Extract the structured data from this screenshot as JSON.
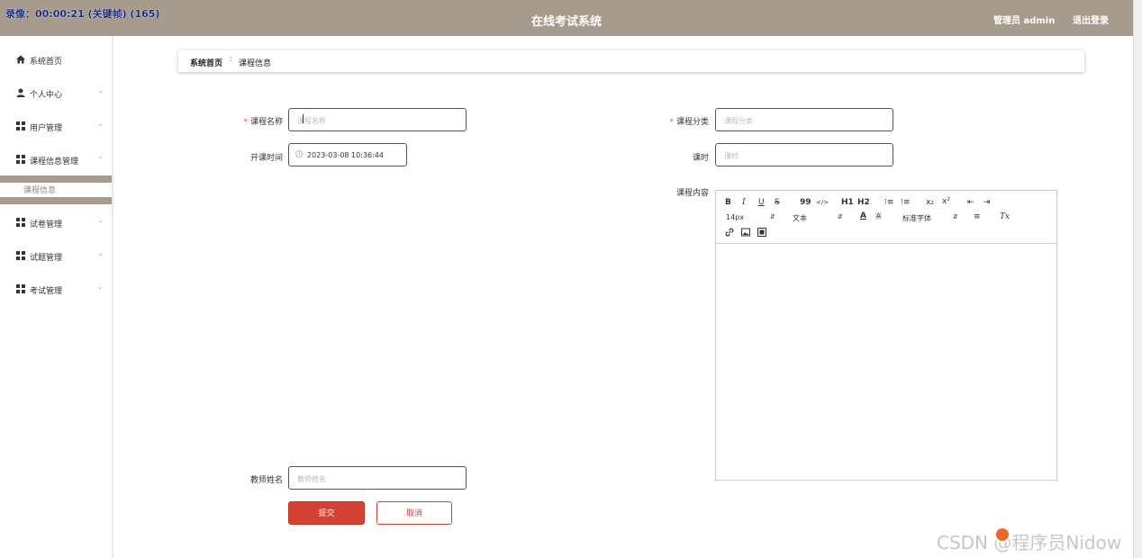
{
  "recorder": {
    "text": "录像：00:00:21 (关键帧) (165)"
  },
  "header": {
    "title": "在线考试系统",
    "user": "管理员 admin",
    "logout": "退出登录",
    "bar_color": "#a69b8c"
  },
  "sidebar": {
    "items": [
      {
        "label": "系统首页",
        "icon": "home-icon"
      },
      {
        "label": "个人中心",
        "icon": "user-icon"
      },
      {
        "label": "用户管理",
        "icon": "grid-icon"
      },
      {
        "label": "课程信息管理",
        "icon": "grid-icon",
        "expanded": true
      },
      {
        "label": "试卷管理",
        "icon": "grid-icon"
      },
      {
        "label": "试题管理",
        "icon": "grid-icon"
      },
      {
        "label": "考试管理",
        "icon": "grid-icon"
      }
    ],
    "sub_item": "课程信息"
  },
  "breadcrumb": {
    "home": "系统首页",
    "separator": "∶",
    "current": "课程信息"
  },
  "form": {
    "course_name": {
      "label": "课程名称",
      "placeholder": "课程名称",
      "required": true
    },
    "course_category": {
      "label": "课程分类",
      "placeholder": "课程分类",
      "required": true
    },
    "start_time": {
      "label": "开课时间",
      "value": "2023-03-08 10:36:44"
    },
    "hours": {
      "label": "课时",
      "placeholder": "课时"
    },
    "content": {
      "label": "课程内容"
    },
    "teacher": {
      "label": "教师姓名",
      "placeholder": "教师姓名"
    },
    "submit": "提交",
    "cancel": "取消"
  },
  "editor": {
    "row1": [
      "B",
      "I",
      "U",
      "S",
      "99",
      "</>",
      "H1",
      "H2",
      "⁝≡",
      "⁝≡",
      "x₂",
      "x²",
      "⇤",
      "⇥"
    ],
    "size": "14px",
    "block": "文本",
    "font": "标准字体",
    "clean": "Tx"
  },
  "watermark": "CSDN @程序员Nidow",
  "colors": {
    "primary": "#d34232",
    "accent": "#a69b8c"
  }
}
